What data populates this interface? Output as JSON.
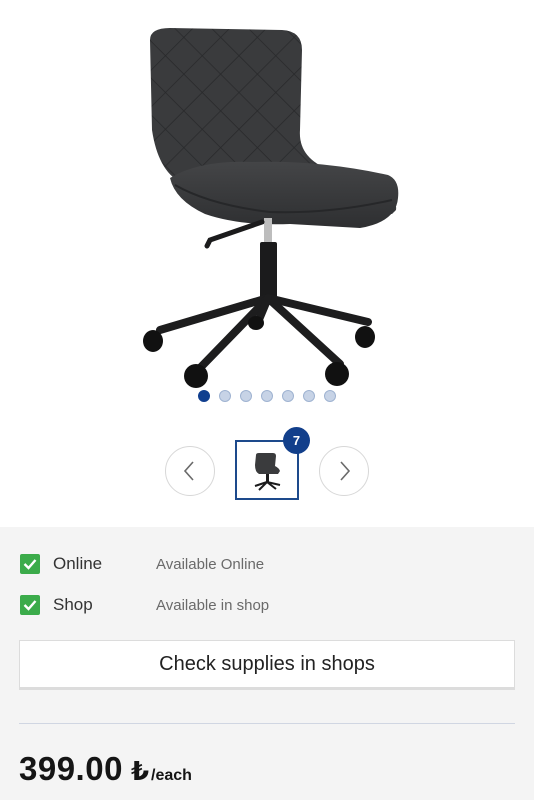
{
  "product": {
    "image_icon": "office-chair-image",
    "carousel": {
      "total_dots": 7,
      "active_index": 0
    },
    "thumbnail_count_badge": "7"
  },
  "availability": [
    {
      "label": "Online",
      "status": "Available Online",
      "checked": true
    },
    {
      "label": "Shop",
      "status": "Available in shop",
      "checked": true
    }
  ],
  "supplies_button_label": "Check supplies in shops",
  "price": {
    "amount": "399.00",
    "currency": "₺",
    "unit": "/each"
  },
  "colors": {
    "accent": "#123f8b",
    "check": "#3bab4a"
  }
}
